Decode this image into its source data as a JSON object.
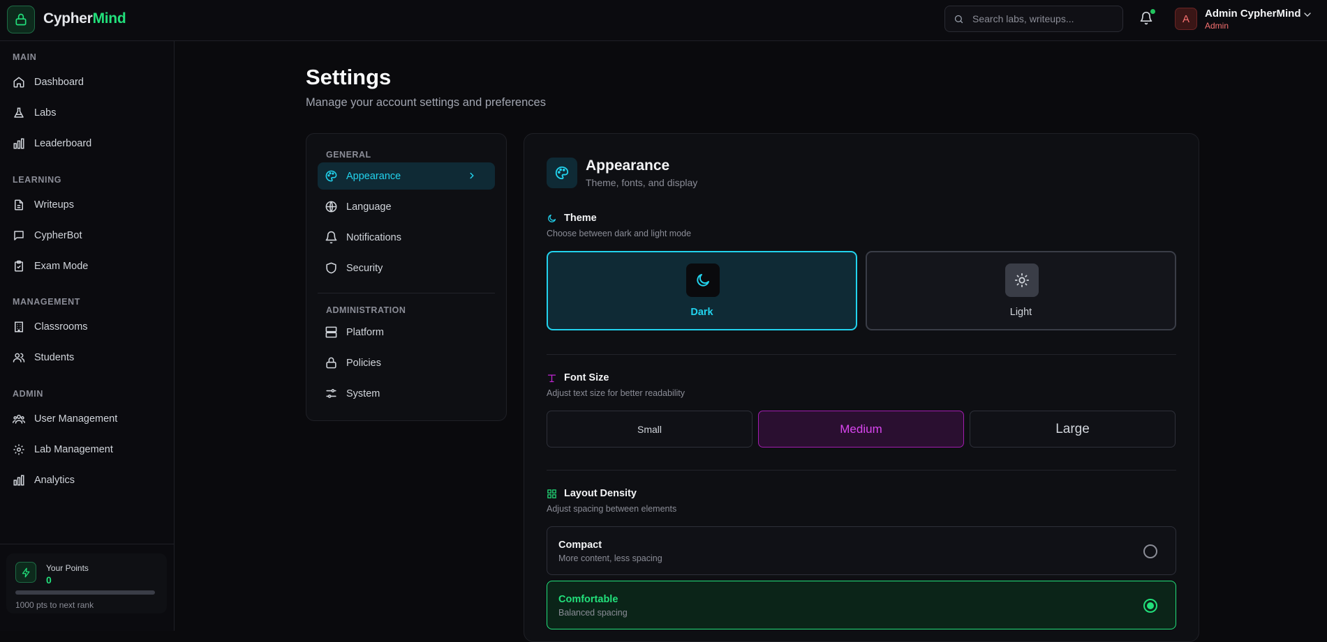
{
  "app": {
    "brand_prefix": "Cypher",
    "brand_suffix": "Mind"
  },
  "header": {
    "search_placeholder": "Search labs, writeups...",
    "user_name": "Admin CypherMind",
    "user_role": "Admin",
    "avatar_initial": "A"
  },
  "sidebar": {
    "main_label": "MAIN",
    "main": [
      "Dashboard",
      "Labs",
      "Leaderboard"
    ],
    "learning_label": "LEARNING",
    "learning": [
      "Writeups",
      "CypherBot",
      "Exam Mode"
    ],
    "management_label": "MANAGEMENT",
    "management": [
      "Classrooms",
      "Students"
    ],
    "admin_label": "ADMIN",
    "admin": [
      "User Management",
      "Lab Management",
      "Analytics"
    ],
    "points": {
      "label": "Your Points",
      "value": "0",
      "progress": 0,
      "next": "1000 pts to next rank"
    }
  },
  "page": {
    "title": "Settings",
    "subtitle": "Manage your account settings and preferences"
  },
  "settings_nav": {
    "general_label": "GENERAL",
    "general": [
      "Appearance",
      "Language",
      "Notifications",
      "Security"
    ],
    "admin_label": "ADMINISTRATION",
    "admin": [
      "Platform",
      "Policies",
      "System"
    ],
    "active": "Appearance"
  },
  "appearance": {
    "title": "Appearance",
    "subtitle": "Theme, fonts, and display",
    "theme": {
      "title": "Theme",
      "subtitle": "Choose between dark and light mode",
      "dark": "Dark",
      "light": "Light",
      "selected": "Dark"
    },
    "font_size": {
      "title": "Font Size",
      "subtitle": "Adjust text size for better readability",
      "small": "Small",
      "medium": "Medium",
      "large": "Large",
      "selected": "Medium"
    },
    "density": {
      "title": "Layout Density",
      "subtitle": "Adjust spacing between elements",
      "compact": {
        "title": "Compact",
        "desc": "More content, less spacing"
      },
      "comfortable": {
        "title": "Comfortable",
        "desc": "Balanced spacing"
      },
      "selected": "Comfortable"
    }
  },
  "colors": {
    "brand": "#22e07b",
    "accent": "#22d3ee",
    "font_accent": "#d946ef",
    "admin": "#f87171"
  }
}
